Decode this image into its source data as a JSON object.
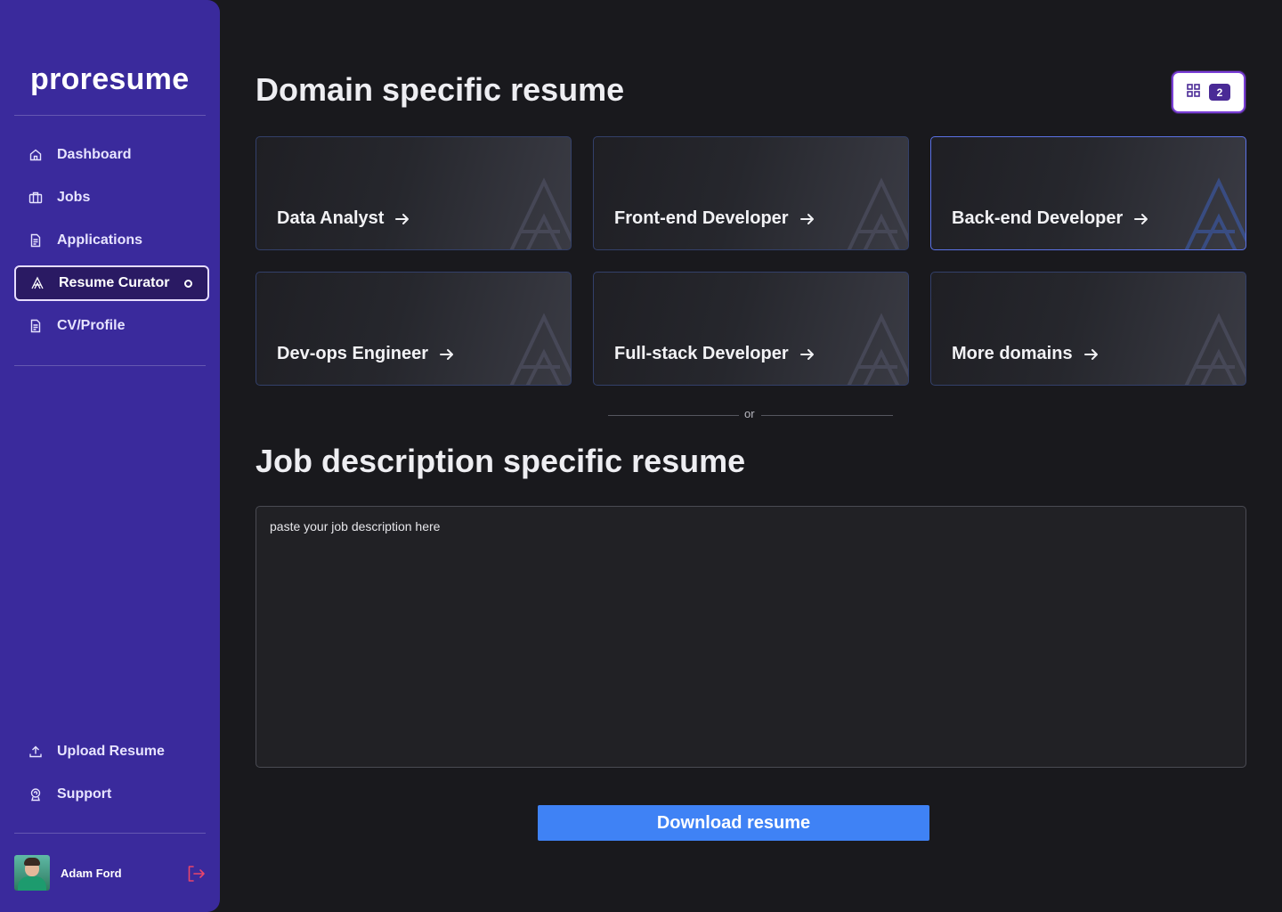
{
  "brand": {
    "name": "proresume"
  },
  "sidebar": {
    "nav": [
      {
        "label": "Dashboard",
        "icon": "home-icon"
      },
      {
        "label": "Jobs",
        "icon": "briefcase-icon"
      },
      {
        "label": "Applications",
        "icon": "document-icon"
      },
      {
        "label": "Resume Curator",
        "icon": "curator-icon",
        "active": true
      },
      {
        "label": "CV/Profile",
        "icon": "document-icon"
      }
    ],
    "bottom": [
      {
        "label": "Upload Resume",
        "icon": "upload-icon"
      },
      {
        "label": "Support",
        "icon": "support-icon"
      }
    ],
    "user": {
      "name": "Adam Ford"
    }
  },
  "main": {
    "domain_title": "Domain specific resume",
    "grid_badge_count": "2",
    "domains": [
      {
        "label": "Data Analyst"
      },
      {
        "label": "Front-end Developer"
      },
      {
        "label": "Back-end Developer",
        "highlighted": true
      },
      {
        "label": "Dev-ops Engineer"
      },
      {
        "label": "Full-stack Developer"
      },
      {
        "label": "More domains"
      }
    ],
    "or_text": "or",
    "jd_title": "Job description specific resume",
    "jd_placeholder": "paste your job description here",
    "download_label": "Download resume"
  },
  "colors": {
    "sidebar_bg": "#3a2a9c",
    "page_bg": "#19191d",
    "primary_button": "#3f82f5",
    "active_outline": "#e6dcff",
    "logout_icon": "#e8456b"
  }
}
